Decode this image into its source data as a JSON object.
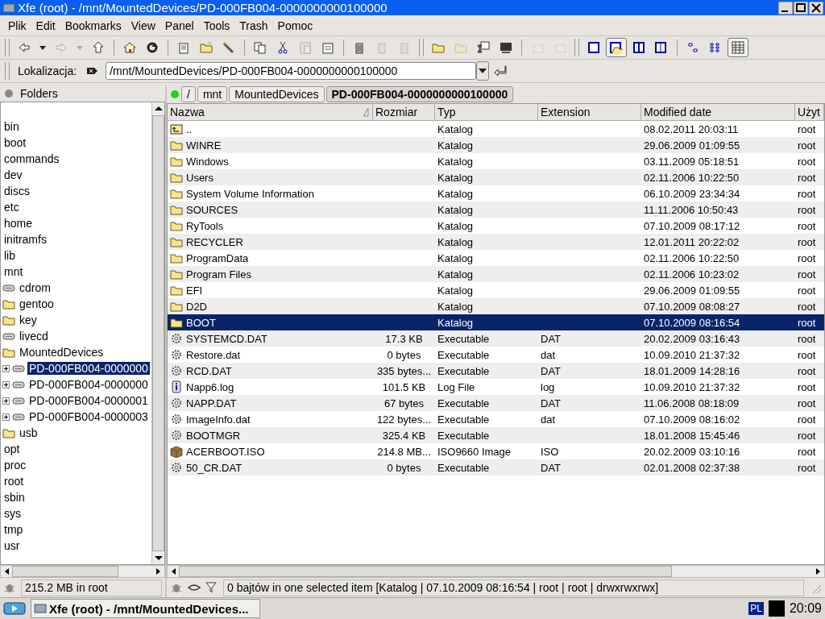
{
  "window": {
    "title": "Xfe (root) - /mnt/MountedDevices/PD-000FB004-0000000000100000"
  },
  "menu": [
    "Plik",
    "Edit",
    "Bookmarks",
    "View",
    "Panel",
    "Tools",
    "Trash",
    "Pomoc"
  ],
  "toolbar": [
    [
      {
        "disabled": false,
        "pressed": false
      },
      {
        "disabled": false,
        "pressed": false
      },
      {
        "disabled": true,
        "pressed": false
      },
      {
        "disabled": true,
        "pressed": false
      },
      {
        "disabled": false,
        "pressed": false
      }
    ],
    [
      {
        "disabled": false,
        "pressed": false
      },
      {
        "disabled": false,
        "pressed": false
      }
    ],
    [
      {
        "disabled": false,
        "pressed": false
      },
      {
        "disabled": false,
        "pressed": false
      },
      {
        "disabled": false,
        "pressed": false
      }
    ],
    [
      {
        "disabled": false,
        "pressed": false
      },
      {
        "disabled": false,
        "pressed": false
      },
      {
        "disabled": true,
        "pressed": false
      },
      {
        "disabled": false,
        "pressed": false
      }
    ],
    [
      {
        "disabled": false,
        "pressed": false
      },
      {
        "disabled": true,
        "pressed": false
      },
      {
        "disabled": true,
        "pressed": false
      }
    ],
    [
      {
        "disabled": false,
        "pressed": false
      },
      {
        "disabled": true,
        "pressed": false
      },
      {
        "disabled": false,
        "pressed": false
      },
      {
        "disabled": false,
        "pressed": false
      }
    ],
    [
      {
        "disabled": true,
        "pressed": false
      },
      {
        "disabled": true,
        "pressed": false
      }
    ],
    [
      {
        "disabled": false,
        "pressed": false
      },
      {
        "disabled": false,
        "pressed": true
      },
      {
        "disabled": false,
        "pressed": false
      },
      {
        "disabled": false,
        "pressed": false
      }
    ],
    [
      {
        "disabled": false,
        "pressed": false
      },
      {
        "disabled": false,
        "pressed": false
      },
      {
        "disabled": false,
        "pressed": true
      }
    ]
  ],
  "location": {
    "label": "Lokalizacja:",
    "value": "/mnt/MountedDevices/PD-000FB004-0000000000100000"
  },
  "folders": {
    "title": "Folders",
    "status": "215.2 MB in root",
    "tree": [
      {
        "label": "bin"
      },
      {
        "label": "boot"
      },
      {
        "label": "commands"
      },
      {
        "label": "dev"
      },
      {
        "label": "discs"
      },
      {
        "label": "etc"
      },
      {
        "label": "home"
      },
      {
        "label": "initramfs"
      },
      {
        "label": "lib"
      },
      {
        "label": "mnt",
        "expanded": true,
        "children": [
          {
            "label": "cdrom",
            "kind": "drive"
          },
          {
            "label": "gentoo",
            "kind": "folder"
          },
          {
            "label": "key",
            "kind": "folder"
          },
          {
            "label": "livecd",
            "kind": "drive"
          },
          {
            "label": "MountedDevices",
            "kind": "folder",
            "expanded": true,
            "children": [
              {
                "label": "PD-000FB004-0000000",
                "kind": "drive",
                "expanded": false,
                "selected": true
              },
              {
                "label": "PD-000FB004-0000000",
                "kind": "drive",
                "expanded": false,
                "selected": false
              },
              {
                "label": "PD-000FB004-0000001",
                "kind": "drive",
                "expanded": false,
                "selected": false
              },
              {
                "label": "PD-000FB004-0000003",
                "kind": "drive",
                "expanded": false,
                "selected": false
              }
            ]
          },
          {
            "label": "usb",
            "kind": "folder"
          }
        ]
      },
      {
        "label": "opt"
      },
      {
        "label": "proc"
      },
      {
        "label": "root"
      },
      {
        "label": "sbin"
      },
      {
        "label": "sys"
      },
      {
        "label": "tmp"
      },
      {
        "label": "usr"
      }
    ]
  },
  "breadcrumb": [
    {
      "label": "/",
      "selected": false
    },
    {
      "label": "mnt",
      "selected": false
    },
    {
      "label": "MountedDevices",
      "selected": false
    },
    {
      "label": "PD-000FB004-0000000000100000",
      "selected": true
    }
  ],
  "table": {
    "columns": [
      "Nazwa",
      "Rozmiar",
      "Typ",
      "Extension",
      "Modified date",
      "Użyt"
    ],
    "rows": [
      {
        "kind": "parent",
        "cells": [
          "..",
          "",
          "Katalog",
          "",
          "08.02.2011 20:03:11",
          "root"
        ],
        "selected": false
      },
      {
        "kind": "folder",
        "cells": [
          "WINRE",
          "",
          "Katalog",
          "",
          "29.06.2009 01:09:55",
          "root"
        ],
        "selected": false
      },
      {
        "kind": "folder",
        "cells": [
          "Windows",
          "",
          "Katalog",
          "",
          "03.11.2009 05:18:51",
          "root"
        ],
        "selected": false
      },
      {
        "kind": "folder",
        "cells": [
          "Users",
          "",
          "Katalog",
          "",
          "02.11.2006 10:22:50",
          "root"
        ],
        "selected": false
      },
      {
        "kind": "folder",
        "cells": [
          "System Volume Information",
          "",
          "Katalog",
          "",
          "06.10.2009 23:34:34",
          "root"
        ],
        "selected": false
      },
      {
        "kind": "folder",
        "cells": [
          "SOURCES",
          "",
          "Katalog",
          "",
          "11.11.2006 10:50:43",
          "root"
        ],
        "selected": false
      },
      {
        "kind": "folder",
        "cells": [
          "RyTools",
          "",
          "Katalog",
          "",
          "07.10.2009 08:17:12",
          "root"
        ],
        "selected": false
      },
      {
        "kind": "folder",
        "cells": [
          "RECYCLER",
          "",
          "Katalog",
          "",
          "12.01.2011 20:22:02",
          "root"
        ],
        "selected": false
      },
      {
        "kind": "folder",
        "cells": [
          "ProgramData",
          "",
          "Katalog",
          "",
          "02.11.2006 10:22:50",
          "root"
        ],
        "selected": false
      },
      {
        "kind": "folder",
        "cells": [
          "Program Files",
          "",
          "Katalog",
          "",
          "02.11.2006 10:23:02",
          "root"
        ],
        "selected": false
      },
      {
        "kind": "folder",
        "cells": [
          "EFI",
          "",
          "Katalog",
          "",
          "29.06.2009 01:09:55",
          "root"
        ],
        "selected": false
      },
      {
        "kind": "folder",
        "cells": [
          "D2D",
          "",
          "Katalog",
          "",
          "07.10.2009 08:08:27",
          "root"
        ],
        "selected": false
      },
      {
        "kind": "folder",
        "cells": [
          "BOOT",
          "",
          "Katalog",
          "",
          "07.10.2009 08:16:54",
          "root"
        ],
        "selected": true
      },
      {
        "kind": "exec",
        "cells": [
          "SYSTEMCD.DAT",
          "17.3 KB",
          "Executable",
          "DAT",
          "20.02.2009 03:16:43",
          "root"
        ],
        "selected": false
      },
      {
        "kind": "exec",
        "cells": [
          "Restore.dat",
          "0 bytes",
          "Executable",
          "dat",
          "10.09.2010 21:37:32",
          "root"
        ],
        "selected": false
      },
      {
        "kind": "exec",
        "cells": [
          "RCD.DAT",
          "335 bytes...",
          "Executable",
          "DAT",
          "18.01.2009 14:28:16",
          "root"
        ],
        "selected": false
      },
      {
        "kind": "log",
        "cells": [
          "Napp6.log",
          "101.5 KB",
          "Log File",
          "log",
          "10.09.2010 21:37:32",
          "root"
        ],
        "selected": false
      },
      {
        "kind": "exec",
        "cells": [
          "NAPP.DAT",
          "67 bytes",
          "Executable",
          "DAT",
          "11.06.2008 08:18:09",
          "root"
        ],
        "selected": false
      },
      {
        "kind": "exec",
        "cells": [
          "ImageInfo.dat",
          "122 bytes...",
          "Executable",
          "dat",
          "07.10.2009 08:16:02",
          "root"
        ],
        "selected": false
      },
      {
        "kind": "exec",
        "cells": [
          "BOOTMGR",
          "325.4 KB",
          "Executable",
          "",
          "18.01.2008 15:45:46",
          "root"
        ],
        "selected": false
      },
      {
        "kind": "iso",
        "cells": [
          "ACERBOOT.ISO",
          "214.8 MB...",
          "ISO9660 Image",
          "ISO",
          "20.02.2009 03:10:16",
          "root"
        ],
        "selected": false
      },
      {
        "kind": "exec",
        "cells": [
          "50_CR.DAT",
          "0 bytes",
          "Executable",
          "DAT",
          "02.01.2008 02:37:38",
          "root"
        ],
        "selected": false
      }
    ]
  },
  "status_bar": "0 bajtów in one selected item [Katalog | 07.10.2009 08:16:54 | root | root | drwxrwxrwx]",
  "taskbar": {
    "task": "Xfe (root) - /mnt/MountedDevices...",
    "keyboard": "PL",
    "clock": "20:09"
  }
}
